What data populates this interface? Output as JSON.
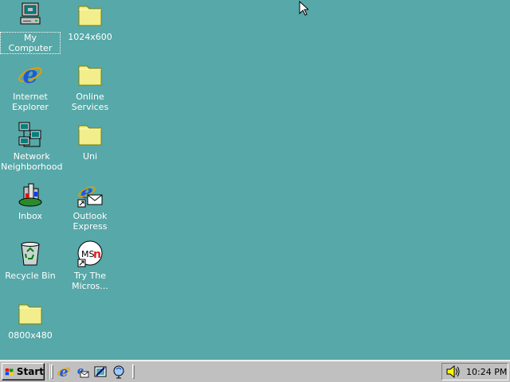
{
  "desktop": {
    "icons": [
      {
        "label": "My Computer",
        "icon": "my-computer-icon"
      },
      {
        "label": "1024x600",
        "icon": "folder-icon"
      },
      {
        "label": "Internet\nExplorer",
        "icon": "internet-explorer-icon"
      },
      {
        "label": "Online\nServices",
        "icon": "folder-icon"
      },
      {
        "label": "Network\nNeighborhood",
        "icon": "network-neighborhood-icon"
      },
      {
        "label": "Uni",
        "icon": "folder-icon"
      },
      {
        "label": "Inbox",
        "icon": "inbox-icon"
      },
      {
        "label": "Outlook\nExpress",
        "icon": "outlook-express-icon"
      },
      {
        "label": "Recycle Bin",
        "icon": "recycle-bin-icon"
      },
      {
        "label": "Try The\nMicros...",
        "icon": "msn-icon"
      },
      {
        "label": "0800x480",
        "icon": "folder-icon"
      }
    ]
  },
  "taskbar": {
    "start_label": "Start",
    "quick_launch": [
      "internet-explorer-icon",
      "outlook-express-icon",
      "show-desktop-icon",
      "channels-icon"
    ],
    "tray": {
      "clock": "10:24 PM",
      "volume_icon": "speaker-icon"
    }
  },
  "colors": {
    "desktop": "#57a8a8",
    "taskbar": "#c0c0c0",
    "folder": "#f2ee8c"
  }
}
